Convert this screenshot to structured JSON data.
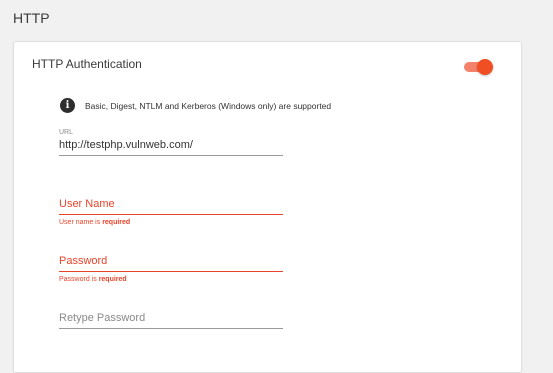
{
  "page": {
    "section_title": "HTTP"
  },
  "card": {
    "title": "HTTP Authentication",
    "toggle_on": true,
    "info_icon": "info-icon",
    "info_text": "Basic, Digest, NTLM and Kerberos (Windows only) are supported"
  },
  "fields": {
    "url": {
      "label": "URL",
      "value": "http://testphp.vulnweb.com/"
    },
    "username": {
      "placeholder": "User Name",
      "error_prefix": "User name is ",
      "error_emphasis": "required"
    },
    "password": {
      "placeholder": "Password",
      "error_prefix": "Password is ",
      "error_emphasis": "required"
    },
    "retype_password": {
      "placeholder": "Retype Password"
    }
  },
  "colors": {
    "accent": "#f04e23",
    "error": "#e8442a",
    "toggle_track": "#f4816a"
  }
}
